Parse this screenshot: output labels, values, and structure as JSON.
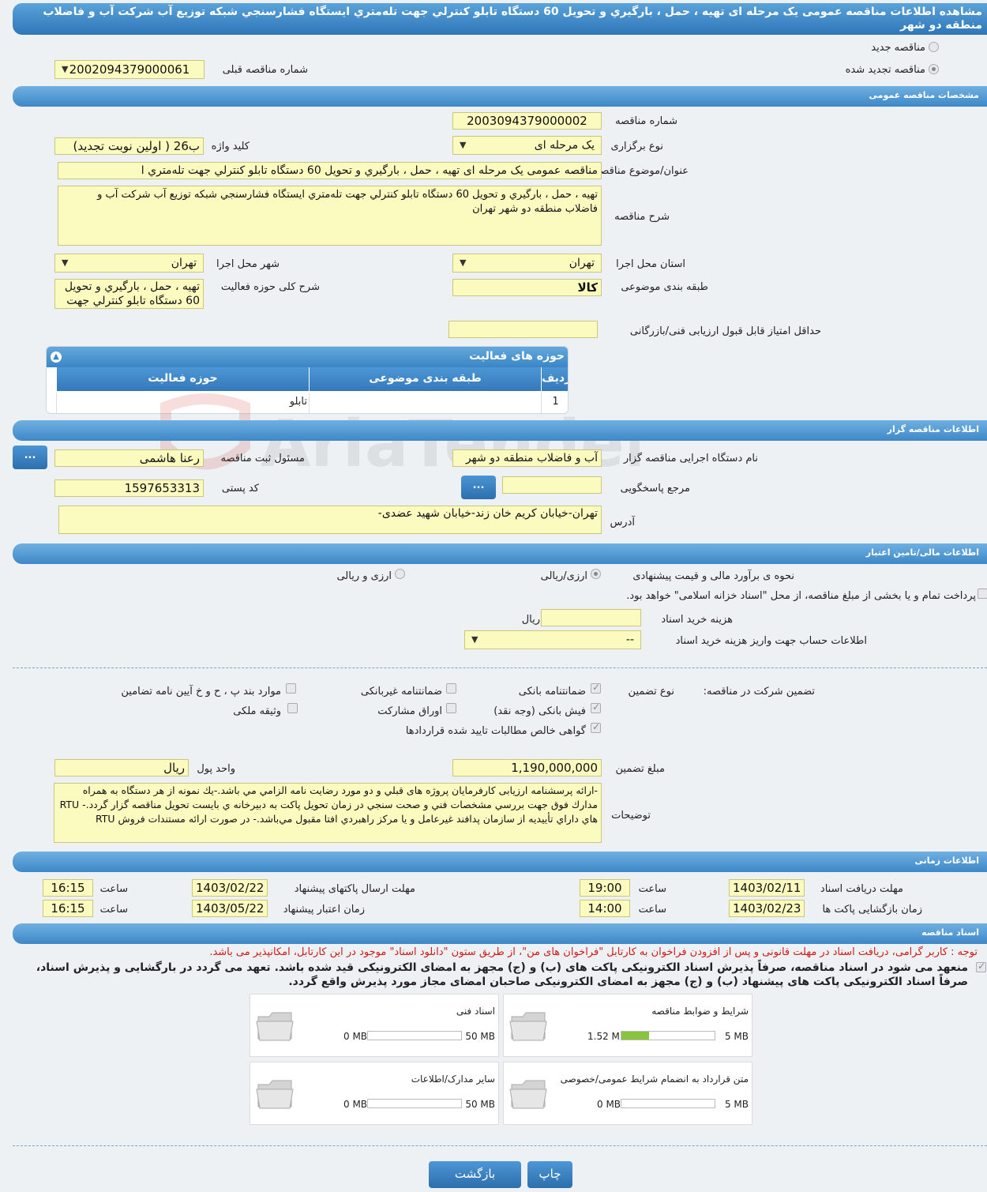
{
  "page_title": "مشاهده اطلاعات مناقصه عمومی یک مرحله ای تهیه ، حمل ، بارگیري و تحویل 60 دستگاه تابلو کنترلي جهت تله‌متري ایستگاه فشارسنجي شبکه توزیع آب شرکت آب و فاضلاب منطقه دو شهر",
  "top": {
    "new_tender_label": "مناقصه جدید",
    "renewed_tender_label": "مناقصه تجدید شده",
    "prev_number_label": "شماره مناقصه قبلی",
    "prev_number_value": "2002094379000061"
  },
  "sections": {
    "general": "مشخصات مناقصه عمومی",
    "organizer": "اطلاعات مناقصه گزار",
    "financial": "اطلاعات مالی/تامین اعتبار",
    "timing": "اطلاعات زمانی",
    "documents": "اسناد مناقصه"
  },
  "general": {
    "number_label": "شماره مناقصه",
    "number_value": "2003094379000002",
    "type_label": "نوع برگزاری",
    "type_value": "یک مرحله ای",
    "keyword_label": "کلید واژه",
    "keyword_value": "ب26 ( اولین نوبت تجدید)",
    "subject_label": "عنوان/موضوع مناقصه",
    "subject_value": "مناقصه عمومی یک مرحله ای تهیه ، حمل ، بارگیري و تحویل 60 دستگاه تابلو کنترلي جهت تله‌متري ا",
    "desc_label": "شرح مناقصه",
    "desc_value": "تهیه ، حمل ، بارگیري و تحویل 60 دستگاه تابلو کنترلي جهت تله‌متري ایستگاه فشارسنجي شبکه توزیع آب شرکت آب و فاضلاب منطقه دو شهر تهران",
    "province_label": "استان محل اجرا",
    "province_value": "تهران",
    "city_label": "شهر محل اجرا",
    "city_value": "تهران",
    "category_label": "طبقه بندی موضوعی",
    "category_value": "کالا",
    "activity_desc_label": "شرح کلی حوزه فعالیت",
    "activity_desc_value": "تهیه ، حمل ، بارگیري و تحویل 60 دستگاه تابلو کنترلي جهت",
    "min_score_label": "حداقل امتیاز قابل قبول ارزیابی فنی/بازرگانی",
    "min_score_value": ""
  },
  "activity_grid": {
    "title": "حوزه های فعالیت",
    "headers": {
      "row": "ردیف",
      "category": "طبقه بندی موضوعی",
      "activity": "حوزه فعالیت"
    },
    "rows": [
      {
        "row": "1",
        "category": "",
        "activity": "تابلو"
      }
    ]
  },
  "organizer": {
    "org_label": "نام دستگاه اجرایی مناقصه گزار",
    "org_value": "آب و فاضلاب منطقه دو شهر",
    "responsible_label": "مسئول ثبت مناقصه",
    "responsible_value": "رعنا هاشمی",
    "dots": "...",
    "ref_label": "مرجع پاسخگویی",
    "ref_value": "",
    "postal_label": "کد پستی",
    "postal_value": "1597653313",
    "address_label": "آدرس",
    "address_value": "تهران-خیابان کریم خان زند-خیابان شهید عضدی-"
  },
  "financial": {
    "estimate_label": "نحوه ی برآورد مالی و قیمت پیشنهادی",
    "opt_rial": "ارزی/ریالی",
    "opt_fx": "ارزی و ریالی",
    "treasury_label": "پرداخت تمام و یا بخشی از مبلغ مناقصه، از محل \"اسناد خزانه اسلامی\" خواهد بود.",
    "doc_cost_label": "هزینه خرید اسناد",
    "doc_cost_value": "",
    "doc_cost_unit": "ریال",
    "account_label": "اطلاعات حساب جهت واریز هزینه خرید اسناد",
    "account_value": "--",
    "guarantee_label": "تضمین شرکت در مناقصه:",
    "guarantee_type_label": "نوع تضمین",
    "g_bank": "ضمانتنامه بانکی",
    "g_nonbank": "ضمانتنامه غیربانکی",
    "g_clauses": "موارد بند پ ، ح و خ آیین نامه تضامین",
    "g_cash": "فیش بانکی (وجه نقد)",
    "g_bonds": "اوراق مشارکت",
    "g_property": "وثیقه ملکی",
    "g_claims": "گواهی خالص مطالبات تایید شده قراردادها",
    "amount_label": "مبلغ تضمین",
    "amount_value": "1,190,000,000",
    "currency_label": "واحد پول",
    "currency_value": "ریال",
    "notes_label": "توضیحات",
    "notes_value": "-ارائه پرسشنامه ارزیابی کارفرمایان پروژه های قبلي و دو مورد رضایت نامه الزامي مي باشد.-یك نمونه از هر دستگاه به همراه مدارك فوق جهت بررسي مشخصات فني و صحت سنجي در زمان تحویل پاكت به دبیرخانه  ي بایست تحویل مناقصه گزار گردد.-     RTU  هاي داراي تأییدیه از سازمان پدافند غیرعامل و یا مرکز راهبردي افتا مقبول مي‌باشد.- در صورت ارائه مستندات فروش RTU"
  },
  "timing": {
    "doc_deadline_label": "مهلت دریافت اسناد",
    "doc_deadline_date": "1403/02/11",
    "doc_deadline_time": "19:00",
    "send_deadline_label": "مهلت ارسال پاکتهای پیشنهاد",
    "send_deadline_date": "1403/02/22",
    "send_deadline_time": "16:15",
    "opening_label": "زمان بازگشایی پاکت ها",
    "opening_date": "1403/02/23",
    "opening_time": "14:00",
    "validity_label": "زمان اعتبار پیشنهاد",
    "validity_date": "1403/05/22",
    "validity_time": "16:15",
    "time_label": "ساعت"
  },
  "documents": {
    "red_note": "توجه : کاربر گرامی، دریافت اسناد در مهلت قانونی و پس از افزودن فراخوان به کارتابل \"فراخوان های من\"، از طریق ستون \"دانلود اسناد\" موجود در این کارتابل، امکانپذیر می باشد.",
    "bold_note": "منعهد می شود در اسناد مناقصه، صرفاً پذیرش اسناد الکترونیکی پاکت های (ب) و (ج) مجهز به امضای الکترونیکی قید شده باشد. تعهد می گردد در بارگشایی و پذیرش اسناد، صرفاً اسناد الکترونیکی پاکت های پیشنهاد (ب) و (ج) مجهز به امضای الکترونیکی صاحبان امضای مجاز مورد پذیرش واقع گردد.",
    "files": [
      {
        "title": "شرایط و ضوابط مناقصه",
        "current": "1.52 MB",
        "max": "5 MB",
        "fill": 0.3
      },
      {
        "title": "اسناد فنی",
        "current": "0 MB",
        "max": "50 MB",
        "fill": 0
      },
      {
        "title": "متن قرارداد به انضمام شرایط عمومی/خصوصی",
        "current": "0 MB",
        "max": "5 MB",
        "fill": 0
      },
      {
        "title": "سایر مدارک/اطلاعات",
        "current": "0 MB",
        "max": "50 MB",
        "fill": 0
      }
    ]
  },
  "footer": {
    "print": "چاپ",
    "back": "بازگشت"
  },
  "watermark": "AriaTender.neT"
}
